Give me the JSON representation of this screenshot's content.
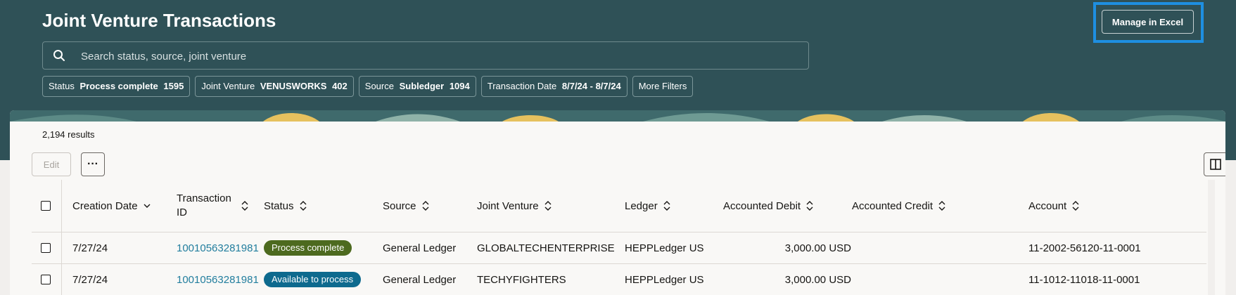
{
  "header": {
    "title": "Joint Venture Transactions",
    "manage_excel_label": "Manage in Excel",
    "search": {
      "placeholder": "Search status, source, joint venture",
      "value": ""
    },
    "filters": [
      {
        "label": "Status",
        "value": "Process complete",
        "count": "1595"
      },
      {
        "label": "Joint Venture",
        "value": "VENUSWORKS",
        "count": "402"
      },
      {
        "label": "Source",
        "value": "Subledger",
        "count": "1094"
      },
      {
        "label": "Transaction Date",
        "value": "8/7/24 - 8/7/24",
        "count": ""
      },
      {
        "label": "More Filters",
        "value": "",
        "count": ""
      }
    ]
  },
  "toolbar": {
    "results_count": "2,194",
    "results_label": "results",
    "edit_label": "Edit",
    "more_label": "···"
  },
  "table": {
    "columns": [
      "Creation Date",
      "Transaction ID",
      "Status",
      "Source",
      "Joint Venture",
      "Ledger",
      "Accounted Debit",
      "Accounted Credit",
      "Account"
    ],
    "rows": [
      {
        "creation_date": "7/27/24",
        "transaction_id": "10010563281981",
        "status": "Process complete",
        "status_color": "#4d6a1f",
        "source": "General Ledger",
        "joint_venture": "GLOBALTECHENTERPRISE",
        "ledger": "HEPPLedger US",
        "accounted_debit": "3,000.00 USD",
        "accounted_credit": "",
        "account": "11-2002-56120-11-0001"
      },
      {
        "creation_date": "7/27/24",
        "transaction_id": "10010563281981",
        "status": "Available to process",
        "status_color": "#0e6a8e",
        "source": "General Ledger",
        "joint_venture": "TECHYFIGHTERS",
        "ledger": "HEPPLedger US",
        "accounted_debit": "3,000.00 USD",
        "accounted_credit": "",
        "account": "11-1012-11018-11-0001"
      }
    ]
  },
  "colors": {
    "header_bg": "#2f5157",
    "focus_outline": "#1e8fe1",
    "link": "#227e9e"
  }
}
